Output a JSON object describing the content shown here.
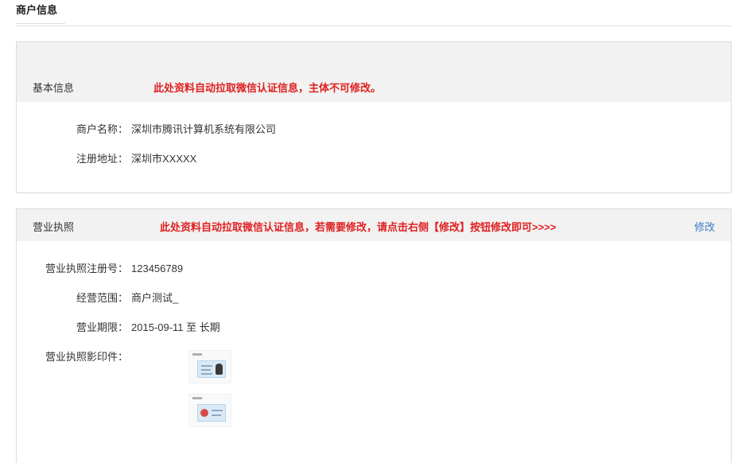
{
  "page": {
    "tab_label": "商户信息"
  },
  "basic_info": {
    "title": "基本信息",
    "notice": "此处资料自动拉取微信认证信息，主体不可修改。",
    "fields": [
      {
        "label": "商户名称：",
        "value": "深圳市腾讯计算机系统有限公司"
      },
      {
        "label": "注册地址：",
        "value": "深圳市XXXXX"
      }
    ]
  },
  "license_info": {
    "title": "营业执照",
    "notice": "此处资料自动拉取微信认证信息，若需要修改，请点击右侧【修改】按钮修改即可>>>>",
    "edit_label": "修改",
    "fields": [
      {
        "label": "营业执照注册号：",
        "value": "123456789"
      },
      {
        "label": "经营范围：",
        "value": "商户测试_"
      },
      {
        "label": "营业期限：",
        "value": "2015-09-11 至 长期"
      }
    ],
    "photo_label": "营业执照影印件："
  },
  "colors": {
    "notice": "#e02020",
    "link": "#3a7bc8",
    "panel_header": "#f2f2f2"
  }
}
